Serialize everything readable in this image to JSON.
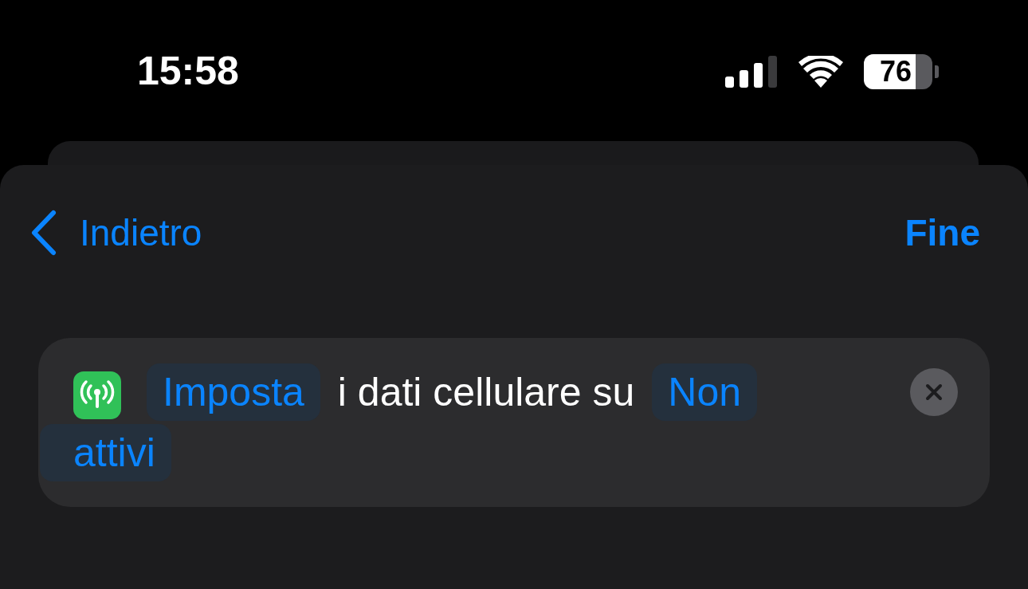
{
  "status_bar": {
    "time": "15:58",
    "battery": "76"
  },
  "nav": {
    "back": "Indietro",
    "done": "Fine"
  },
  "action": {
    "parts": [
      {
        "kind": "token",
        "text": "Imposta"
      },
      {
        "kind": "text",
        "text": "i dati cellulare su"
      },
      {
        "kind": "token",
        "lines": [
          "Non",
          "attivi"
        ]
      }
    ]
  }
}
